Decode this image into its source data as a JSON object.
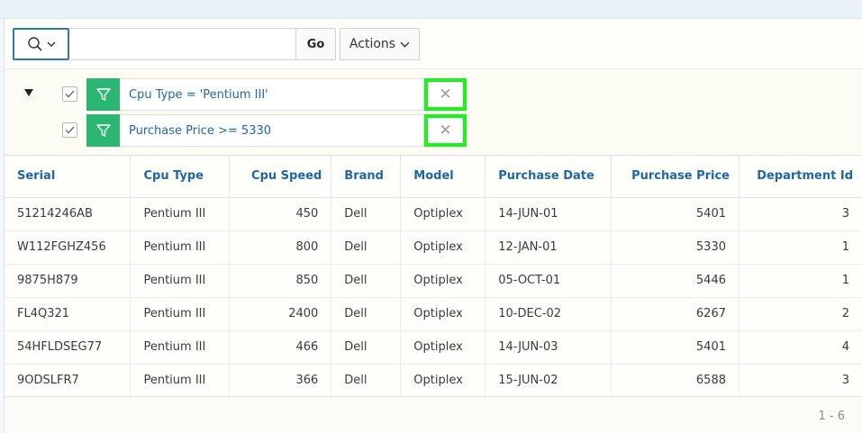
{
  "toolbar": {
    "search_value": "",
    "go_label": "Go",
    "actions_label": "Actions"
  },
  "filters": [
    {
      "expression": "Cpu Type = 'Pentium III'",
      "enabled": true
    },
    {
      "expression": "Purchase Price >= 5330",
      "enabled": true
    }
  ],
  "table": {
    "columns": [
      "Serial",
      "Cpu Type",
      "Cpu Speed",
      "Brand",
      "Model",
      "Purchase Date",
      "Purchase Price",
      "Department Id"
    ],
    "rows": [
      [
        "51214246AB",
        "Pentium III",
        "450",
        "Dell",
        "Optiplex",
        "14-JUN-01",
        "5401",
        "3"
      ],
      [
        "W112FGHZ456",
        "Pentium III",
        "800",
        "Dell",
        "Optiplex",
        "12-JAN-01",
        "5330",
        "1"
      ],
      [
        "9875H879",
        "Pentium III",
        "850",
        "Dell",
        "Optiplex",
        "05-OCT-01",
        "5446",
        "1"
      ],
      [
        "FL4Q321",
        "Pentium III",
        "2400",
        "Dell",
        "Optiplex",
        "10-DEC-02",
        "6267",
        "2"
      ],
      [
        "54HFLDSEG77",
        "Pentium III",
        "466",
        "Dell",
        "Optiplex",
        "14-JUN-03",
        "5401",
        "4"
      ],
      [
        "9ODSLFR7",
        "Pentium III",
        "366",
        "Dell",
        "Optiplex",
        "15-JUN-02",
        "6588",
        "3"
      ]
    ]
  },
  "pagination": {
    "label": "1 - 6"
  },
  "colors": {
    "link_blue": "#1f66a8",
    "filter_green": "#2bb673",
    "highlight_green": "#1cf31c",
    "search_border": "#2a7ab0"
  },
  "icons": {
    "search": "magnifier-icon",
    "dropdown": "chevron-down-icon",
    "collapse": "triangle-down-icon",
    "filter": "funnel-icon",
    "checkbox": "check-icon",
    "remove": "close-icon"
  }
}
